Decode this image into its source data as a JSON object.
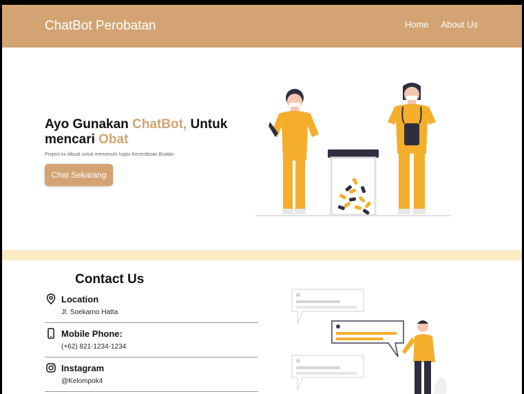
{
  "header": {
    "brand": "ChatBot Perobatan",
    "nav": [
      {
        "label": "Home"
      },
      {
        "label": "About Us"
      }
    ]
  },
  "hero": {
    "title_part1": "Ayo Gunakan ",
    "title_accent1": "ChatBot,",
    "title_part2": " Untuk mencari ",
    "title_accent2": "Obat",
    "subtitle": "Project ini dibuat untuk memenuhi tugas Kecerdasan Buatan",
    "cta_label": "Chat Sekarang"
  },
  "contact": {
    "title": "Contact Us",
    "items": [
      {
        "icon": "location-pin-icon",
        "label": "Location",
        "value": "Jl. Soekarno Hatta"
      },
      {
        "icon": "mobile-phone-icon",
        "label": "Mobile Phone:",
        "value": "(+62) 821-1234-1234"
      },
      {
        "icon": "instagram-icon",
        "label": "Instagram",
        "value": "@Kelompok4"
      }
    ]
  },
  "colors": {
    "brand": "#d3a373",
    "band": "#fbebc5",
    "illustration_yellow": "#f4ae2c",
    "illustration_dark": "#2f2e41"
  }
}
